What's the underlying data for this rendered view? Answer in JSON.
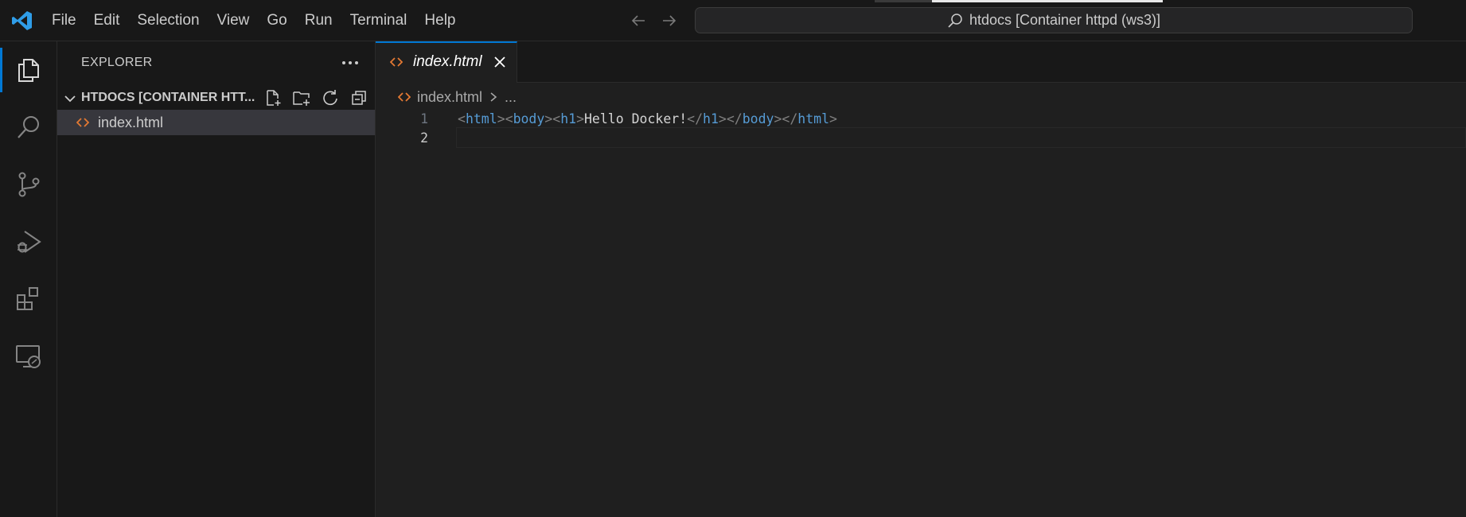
{
  "app": {
    "name": "Visual Studio Code"
  },
  "titlebar": {
    "menu": [
      "File",
      "Edit",
      "Selection",
      "View",
      "Go",
      "Run",
      "Terminal",
      "Help"
    ],
    "search_text": "htdocs [Container httpd (ws3)]",
    "icons": {
      "back": "arrow-left-icon",
      "forward": "arrow-right-icon",
      "search": "search-icon",
      "logo": "vscode-logo-icon"
    }
  },
  "activitybar": {
    "items": [
      "explorer-icon",
      "search-icon",
      "source-control-icon",
      "run-debug-icon",
      "extensions-icon",
      "remote-explorer-icon"
    ],
    "active": "explorer-icon",
    "accent": "#0078d4"
  },
  "sidebar": {
    "header": "EXPLORER",
    "section_title": "HTDOCS [CONTAINER HTT...",
    "section_actions": [
      "new-file-icon",
      "new-folder-icon",
      "refresh-icon",
      "collapse-all-icon"
    ],
    "files": [
      {
        "name": "index.html",
        "icon": "html-file-icon",
        "selected": true
      }
    ]
  },
  "editor": {
    "tabs": [
      {
        "label": "index.html",
        "icon": "html-file-icon",
        "active": true,
        "preview": true
      }
    ],
    "breadcrumb": [
      "index.html",
      "..."
    ],
    "lines": [
      {
        "number": "1",
        "tokens": [
          {
            "t": "<",
            "k": "punct"
          },
          {
            "t": "html",
            "k": "tag"
          },
          {
            "t": ">",
            "k": "punct"
          },
          {
            "t": "<",
            "k": "punct"
          },
          {
            "t": "body",
            "k": "tag"
          },
          {
            "t": ">",
            "k": "punct"
          },
          {
            "t": "<",
            "k": "punct"
          },
          {
            "t": "h1",
            "k": "tag"
          },
          {
            "t": ">",
            "k": "punct"
          },
          {
            "t": "Hello Docker!",
            "k": "text"
          },
          {
            "t": "</",
            "k": "punct"
          },
          {
            "t": "h1",
            "k": "tag"
          },
          {
            "t": ">",
            "k": "punct"
          },
          {
            "t": "</",
            "k": "punct"
          },
          {
            "t": "body",
            "k": "tag"
          },
          {
            "t": ">",
            "k": "punct"
          },
          {
            "t": "</",
            "k": "punct"
          },
          {
            "t": "html",
            "k": "tag"
          },
          {
            "t": ">",
            "k": "punct"
          }
        ]
      },
      {
        "number": "2",
        "tokens": [],
        "current": true
      }
    ],
    "colors": {
      "tag": "#569cd6",
      "punct": "#808080",
      "text": "#d4d4d4",
      "file_icon": "#e37933"
    }
  }
}
